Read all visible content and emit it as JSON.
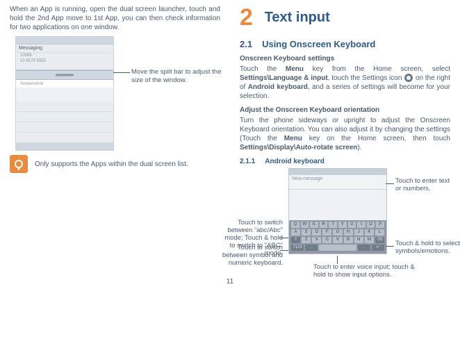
{
  "left": {
    "intro": "When an App is running, open the dual screen launcher, touch and hold the 2nd App move to 1st App, you can then check information for two applications on one window.",
    "splitCallout": "Move the split bar to adjust the size of the window.",
    "note": "Only supports the Apps within the dual screen list.",
    "shot": {
      "header": "Messaging",
      "line1": "10086",
      "line2": "10 6579 5555",
      "popup": "Screenshot"
    }
  },
  "right": {
    "chapterNum": "2",
    "chapterTitle": "Text input",
    "s21num": "2.1",
    "s21title": "Using Onscreen Keyboard",
    "h3a": "Onscreen Keyboard settings",
    "p1a": "Touch the ",
    "p1b": " key from the Home screen, select ",
    "p1c": ", touch the Settings icon ",
    "p1d": " on the right of ",
    "p1e": ", and a series of settings will become for your selection.",
    "menu": "Menu",
    "path1": "Settings\\Language & input",
    "android_kb": "Android keyboard",
    "h3b": "Adjust the Onscreen Keyboard orientation",
    "p2a": "Turn the phone sideways or upright to adjust the Onscreen Keyboard orientation. You can also adjust it by changing the settings (Touch the ",
    "p2b": " key on the Home screen, then touch ",
    "p2c": ").",
    "path2": "Settings\\Display\\Auto-rotate screen",
    "s211num": "2.1.1",
    "s211title": "Android keyboard",
    "kb": {
      "msg": "New message",
      "enterText": "Touch to enter text or numbers.",
      "switchAbc": "Touch to switch between \"abc/Abc\" mode; Touch & hold to switch to \"ABC\" mode.",
      "switchSym": "Touch to switch between symbol and numeric keyboard.",
      "symbols": "Touch & hold to select symbols/emotions.",
      "voice": "Touch to enter voice input; touch & hold to show input options."
    }
  },
  "pageNumber": "11"
}
